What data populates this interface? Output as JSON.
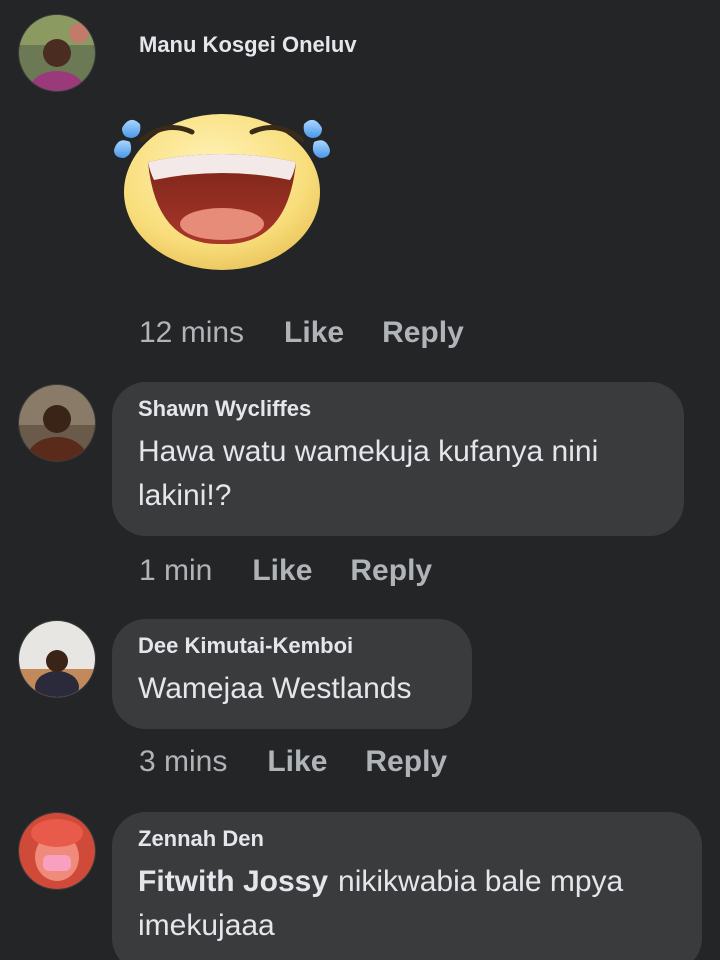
{
  "comments": [
    {
      "author": "Manu Kosgei Oneluv",
      "time": "12 mins",
      "like": "Like",
      "reply": "Reply",
      "sticker": "laughing-tears-emoji"
    },
    {
      "author": "Shawn Wycliffes",
      "text": "Hawa watu wamekuja kufanya nini lakini!?",
      "time": "1 min",
      "like": "Like",
      "reply": "Reply"
    },
    {
      "author": "Dee Kimutai-Kemboi",
      "text": "Wamejaa Westlands",
      "time": "3 mins",
      "like": "Like",
      "reply": "Reply"
    },
    {
      "author": "Zennah Den",
      "mention": "Fitwith Jossy",
      "text": "nikikwabia bale mpya imekujaaa"
    }
  ]
}
